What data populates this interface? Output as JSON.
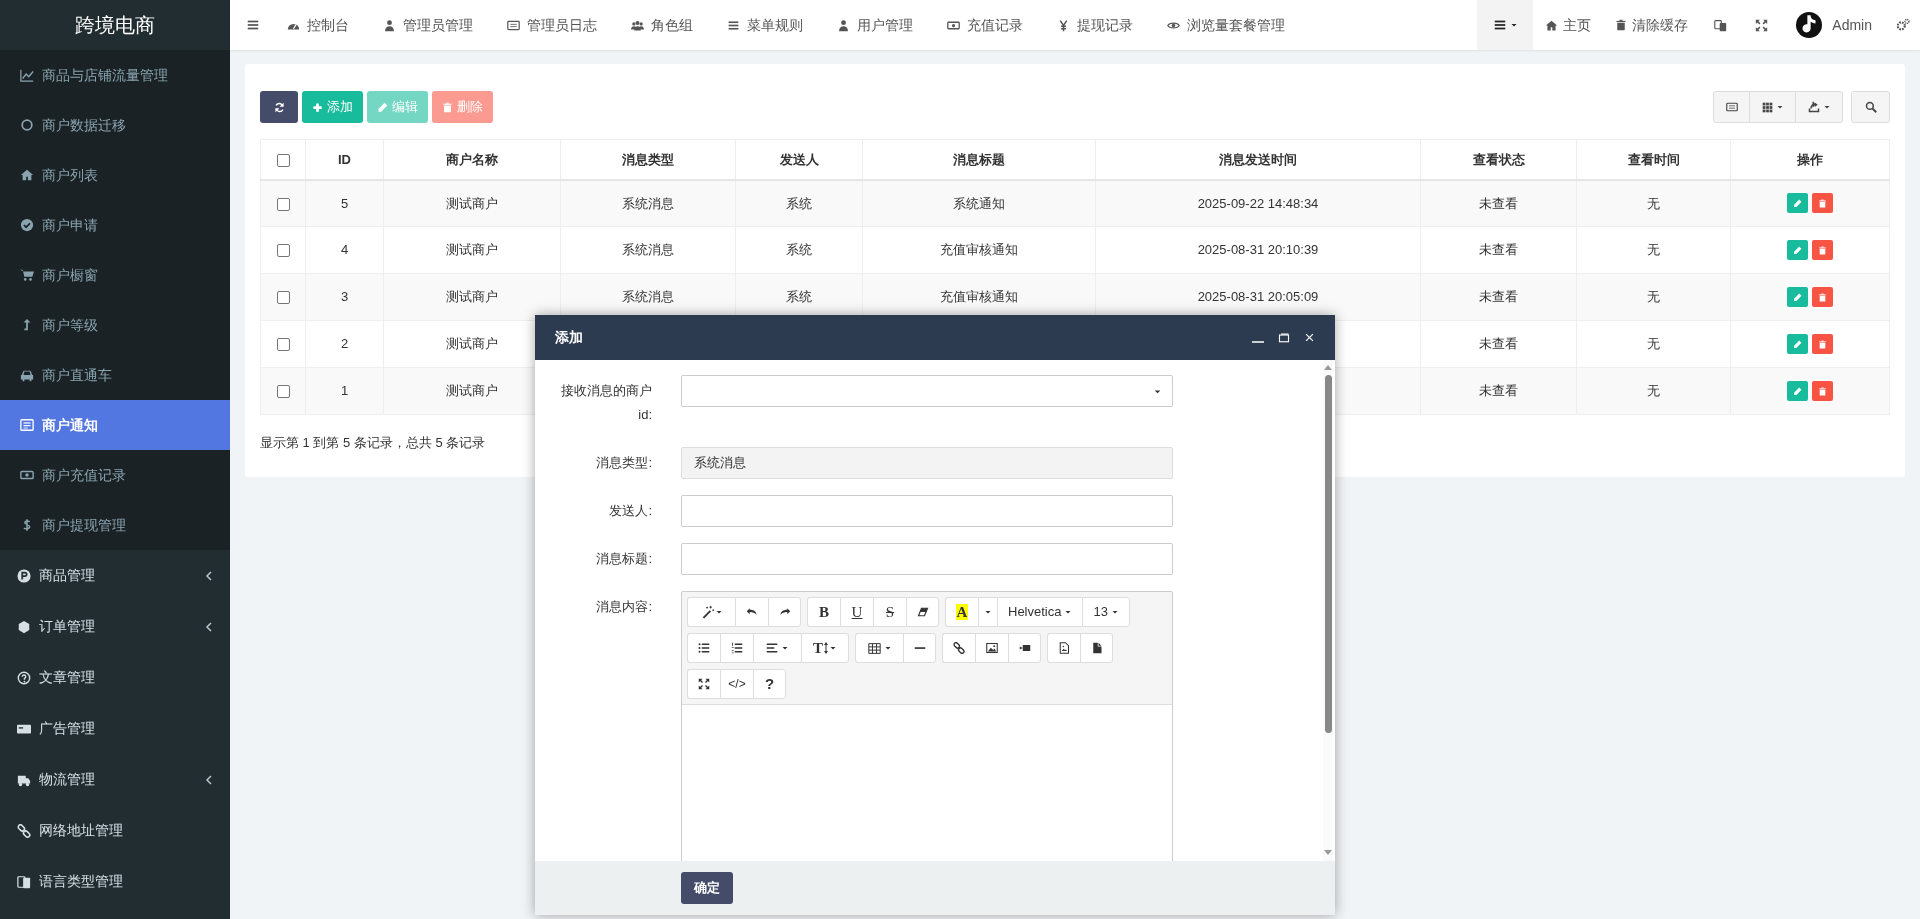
{
  "brand": "跨境电商",
  "top_nav": [
    {
      "label": "控制台"
    },
    {
      "label": "管理员管理"
    },
    {
      "label": "管理员日志"
    },
    {
      "label": "角色组"
    },
    {
      "label": "菜单规则"
    },
    {
      "label": "用户管理"
    },
    {
      "label": "充值记录"
    },
    {
      "label": "提现记录"
    },
    {
      "label": "浏览量套餐管理"
    }
  ],
  "top_right": {
    "home": "主页",
    "clear_cache": "清除缓存",
    "user": "Admin"
  },
  "sidebar": {
    "submenu": [
      {
        "label": "商品与店铺流量管理",
        "selected": false
      },
      {
        "label": "商户数据迁移",
        "selected": false
      },
      {
        "label": "商户列表",
        "selected": false
      },
      {
        "label": "商户申请",
        "selected": false
      },
      {
        "label": "商户橱窗",
        "selected": false
      },
      {
        "label": "商户等级",
        "selected": false
      },
      {
        "label": "商户直通车",
        "selected": false
      },
      {
        "label": "商户通知",
        "selected": true
      },
      {
        "label": "商户充值记录",
        "selected": false
      },
      {
        "label": "商户提现管理",
        "selected": false
      }
    ],
    "items": [
      {
        "label": "商品管理",
        "kind": "group"
      },
      {
        "label": "订单管理",
        "kind": "group"
      },
      {
        "label": "文章管理",
        "kind": "link"
      },
      {
        "label": "广告管理",
        "kind": "link"
      },
      {
        "label": "物流管理",
        "kind": "group"
      },
      {
        "label": "网络地址管理",
        "kind": "link"
      },
      {
        "label": "语言类型管理",
        "kind": "link"
      }
    ]
  },
  "toolbar": [
    {
      "kind": "refresh",
      "disabled": false
    },
    {
      "kind": "add",
      "label": "添加",
      "disabled": false
    },
    {
      "kind": "edit",
      "label": "编辑",
      "disabled": true
    },
    {
      "kind": "delete",
      "label": "删除",
      "disabled": true
    }
  ],
  "table": {
    "select_all_checked": false,
    "columns": [
      "ID",
      "商户名称",
      "消息类型",
      "发送人",
      "消息标题",
      "消息发送时间",
      "查看状态",
      "查看时间",
      "操作"
    ],
    "rows": [
      {
        "checked": false,
        "id": "5",
        "merchant": "测试商户",
        "type": "系统消息",
        "sender": "系统",
        "title": "系统通知",
        "time": "2025-09-22 14:48:34",
        "status": "未查看",
        "view_time": "无"
      },
      {
        "checked": false,
        "id": "4",
        "merchant": "测试商户",
        "type": "系统消息",
        "sender": "系统",
        "title": "充值审核通知",
        "time": "2025-08-31 20:10:39",
        "status": "未查看",
        "view_time": "无"
      },
      {
        "checked": false,
        "id": "3",
        "merchant": "测试商户",
        "type": "系统消息",
        "sender": "系统",
        "title": "充值审核通知",
        "time": "2025-08-31 20:05:09",
        "status": "未查看",
        "view_time": "无"
      },
      {
        "checked": false,
        "id": "2",
        "merchant": "测试商户",
        "status": "未查看",
        "view_time": "无"
      },
      {
        "checked": false,
        "id": "1",
        "merchant": "测试商户",
        "status": "未查看",
        "view_time": "无"
      }
    ]
  },
  "pagination": "显示第 1 到第 5 条记录，总共 5 条记录",
  "modal": {
    "title": "添加",
    "fields": [
      {
        "kind": "select",
        "label": "接收消息的商户id:"
      },
      {
        "kind": "text",
        "label": "消息类型:",
        "value": "系统消息",
        "readonly": true
      },
      {
        "kind": "text",
        "label": "发送人:",
        "readonly": false
      },
      {
        "kind": "text",
        "label": "消息标题:",
        "readonly": false
      },
      {
        "kind": "editor",
        "label": "消息内容:"
      }
    ],
    "editor_toolbar": [
      [
        [
          {
            "kind": "magic"
          },
          {
            "kind": "undo"
          },
          {
            "kind": "redo"
          }
        ],
        [
          {
            "kind": "bold",
            "label": "B"
          },
          {
            "kind": "underline",
            "label": "U"
          },
          {
            "kind": "strike",
            "label": "S"
          },
          {
            "kind": "eraser"
          }
        ],
        [
          {
            "kind": "color",
            "label": "A"
          },
          {
            "kind": "caret"
          },
          {
            "kind": "menu",
            "label": "Helvetica"
          },
          {
            "kind": "menu",
            "label": "13"
          }
        ]
      ],
      [
        [
          {
            "kind": "ul"
          },
          {
            "kind": "ol"
          },
          {
            "kind": "align"
          },
          {
            "kind": "height",
            "label": "T"
          }
        ],
        [
          {
            "kind": "table"
          },
          {
            "kind": "hr"
          }
        ],
        [
          {
            "kind": "link"
          },
          {
            "kind": "picture"
          },
          {
            "kind": "video"
          }
        ],
        [
          {
            "kind": "imagefile"
          },
          {
            "kind": "file"
          }
        ]
      ],
      [
        [
          {
            "kind": "fullscreen"
          },
          {
            "kind": "code",
            "label": "</>"
          },
          {
            "kind": "help",
            "label": "?"
          }
        ]
      ]
    ],
    "submit": "确定"
  }
}
